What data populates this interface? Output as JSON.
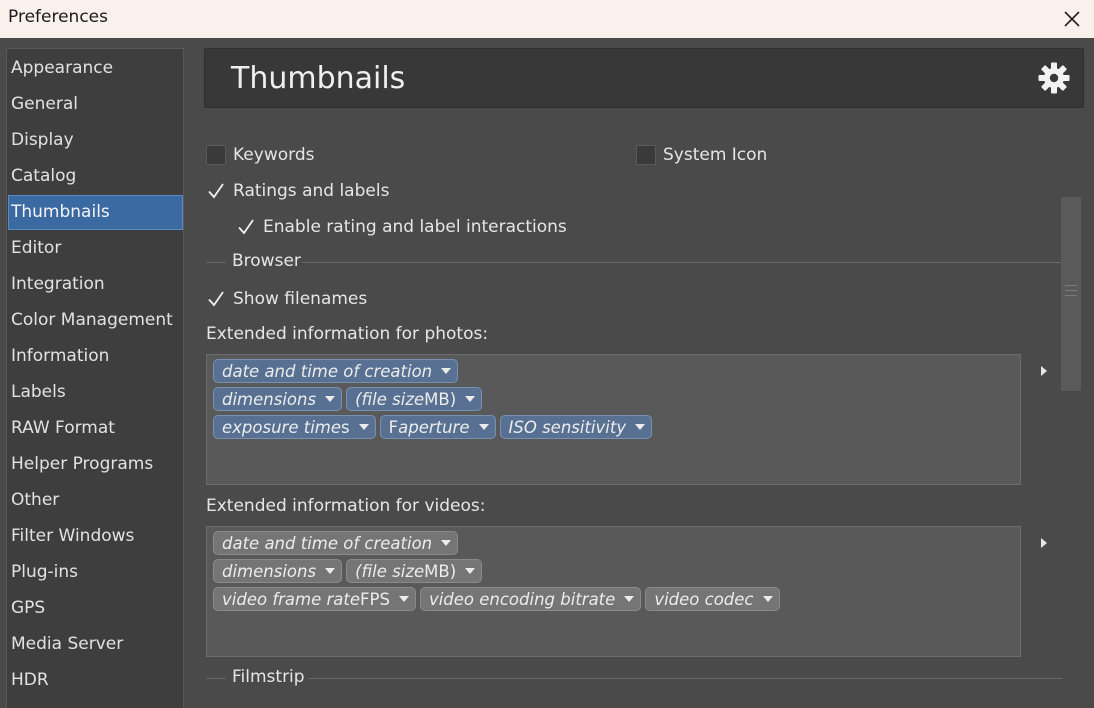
{
  "window": {
    "title": "Preferences"
  },
  "sidebar": {
    "items": [
      {
        "label": "Appearance"
      },
      {
        "label": "General"
      },
      {
        "label": "Display"
      },
      {
        "label": "Catalog"
      },
      {
        "label": "Thumbnails",
        "selected": true
      },
      {
        "label": "Editor"
      },
      {
        "label": "Integration"
      },
      {
        "label": "Color Management"
      },
      {
        "label": "Information"
      },
      {
        "label": "Labels"
      },
      {
        "label": "RAW Format"
      },
      {
        "label": "Helper Programs"
      },
      {
        "label": "Other"
      },
      {
        "label": "Filter Windows"
      },
      {
        "label": "Plug-ins"
      },
      {
        "label": "GPS"
      },
      {
        "label": "Media Server"
      },
      {
        "label": "HDR"
      }
    ]
  },
  "header": {
    "title": "Thumbnails",
    "icon": "gear-icon"
  },
  "options": {
    "keywords": {
      "label": "Keywords",
      "checked": false
    },
    "system_icon": {
      "label": "System Icon",
      "checked": false
    },
    "ratings_labels": {
      "label": "Ratings and labels",
      "checked": true
    },
    "enable_interactions": {
      "label": "Enable rating and label interactions",
      "checked": true
    }
  },
  "browser": {
    "section_label": "Browser",
    "show_filenames": {
      "label": "Show filenames",
      "checked": true
    },
    "photos_label": "Extended information for photos:",
    "photos_tokens": [
      [
        {
          "text": "date and time of creation"
        }
      ],
      [
        {
          "text": "dimensions"
        },
        {
          "prefix": "(file size",
          "plain": " MB)"
        }
      ],
      [
        {
          "text": "exposure time",
          "plain": " s"
        },
        {
          "prefix": "F",
          "text2": "aperture"
        },
        {
          "text": "ISO sensitivity"
        }
      ]
    ],
    "videos_label": "Extended information for videos:",
    "videos_tokens": [
      [
        {
          "text": "date and time of creation"
        }
      ],
      [
        {
          "text": "dimensions"
        },
        {
          "prefix": "(file size",
          "plain": " MB)"
        }
      ],
      [
        {
          "text": "video frame rate",
          "plain": " FPS"
        },
        {
          "text": "video encoding bitrate"
        },
        {
          "text": "video codec"
        }
      ]
    ]
  },
  "filmstrip": {
    "section_label": "Filmstrip"
  },
  "colors": {
    "accent": "#3b6aa3",
    "photo_token": "#587192",
    "video_token": "#757575"
  }
}
